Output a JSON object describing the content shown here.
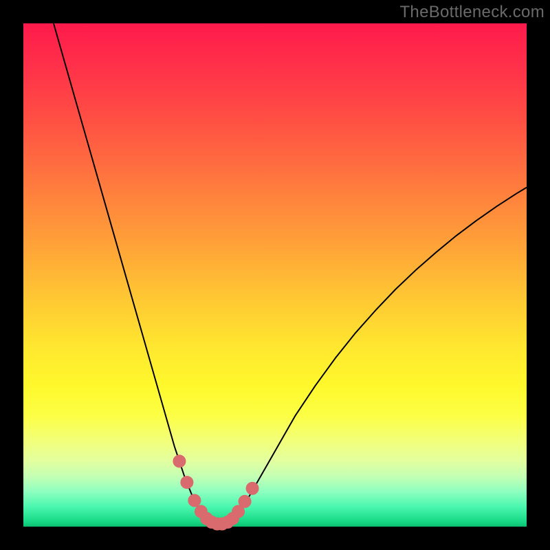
{
  "watermark": "TheBottleneck.com",
  "colors": {
    "curve_stroke": "#000000",
    "marker_fill": "#d96a6d",
    "marker_stroke": "#d96a6d"
  },
  "chart_data": {
    "type": "line",
    "title": "",
    "xlabel": "",
    "ylabel": "",
    "xlim": [
      0,
      100
    ],
    "ylim": [
      0,
      100
    ],
    "grid": false,
    "legend": false,
    "series": [
      {
        "name": "bottleneck-curve",
        "x": [
          6,
          8,
          10,
          12,
          14,
          16,
          18,
          20,
          22,
          24,
          26,
          28,
          30,
          31,
          32,
          33,
          34,
          35,
          36,
          37,
          38,
          39,
          40,
          41,
          42,
          44,
          46,
          48,
          50,
          54,
          58,
          62,
          66,
          70,
          74,
          78,
          82,
          86,
          90,
          94,
          98,
          100
        ],
        "y": [
          100,
          93,
          86,
          79,
          72,
          65,
          58,
          51,
          44,
          37,
          30,
          23,
          16,
          13,
          10,
          7.5,
          5,
          3.2,
          1.8,
          1.0,
          0.6,
          0.5,
          0.6,
          1.0,
          1.8,
          4.5,
          8.0,
          11.5,
          15,
          22,
          28,
          33.5,
          38.5,
          43,
          47.2,
          51,
          54.5,
          57.8,
          60.8,
          63.6,
          66.2,
          67.4
        ]
      }
    ],
    "markers": {
      "name": "highlight-region",
      "x": [
        31.0,
        32.5,
        34.0,
        35.3,
        36.4,
        37.4,
        38.5,
        39.5,
        40.6,
        41.6,
        42.7,
        44.0,
        45.5
      ],
      "y": [
        13.0,
        8.8,
        5.2,
        3.0,
        1.6,
        0.9,
        0.55,
        0.55,
        0.9,
        1.6,
        3.0,
        5.0,
        7.6
      ]
    }
  }
}
